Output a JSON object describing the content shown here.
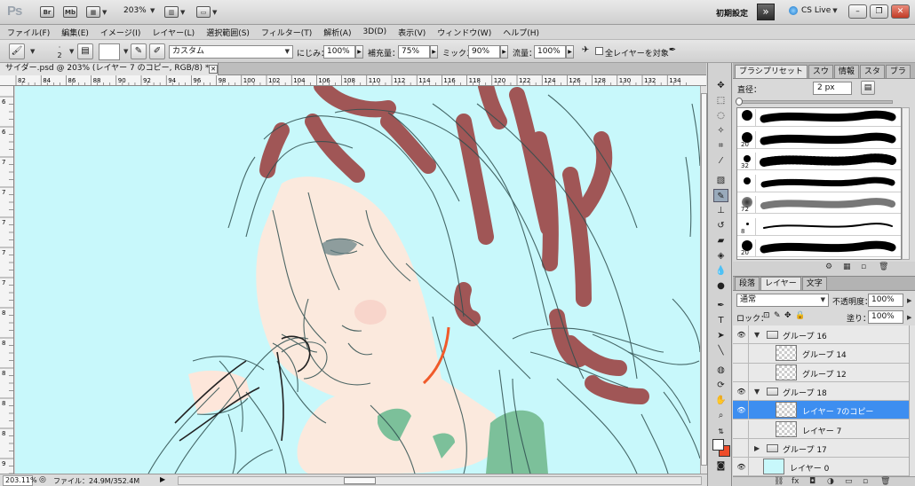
{
  "app": {
    "logo": "Ps",
    "mode_buttons": [
      "Br",
      "Mb"
    ],
    "zoom": "203%",
    "workspace": "初期設定",
    "cs_live": "CS Live"
  },
  "menu": [
    "ファイル(F)",
    "編集(E)",
    "イメージ(I)",
    "レイヤー(L)",
    "選択範囲(S)",
    "フィルター(T)",
    "解析(A)",
    "3D(D)",
    "表示(V)",
    "ウィンドウ(W)",
    "ヘルプ(H)"
  ],
  "options": {
    "brush_size": "2",
    "mode": "カスタム",
    "wet_label": "にじみ：",
    "wet_value": "100%",
    "load_label": "補充量：",
    "load_value": "75%",
    "mix_label": "ミックス：",
    "mix_value": "90%",
    "flow_label": "流量：",
    "flow_value": "100%",
    "sample_all_label": "全レイヤーを対象"
  },
  "document": {
    "tab_title": "サイダー.psd @ 203% (レイヤー 7 のコピー, RGB/8) *",
    "status_zoom": "203.11%",
    "status_file": "ファイル：24.9M/352.4M"
  },
  "ruler": {
    "top": [
      "82",
      "84",
      "86",
      "88",
      "90",
      "92",
      "94",
      "96",
      "98",
      "100",
      "102",
      "104",
      "106",
      "108",
      "110",
      "112",
      "114",
      "116",
      "118",
      "120",
      "122",
      "124",
      "126",
      "128",
      "130",
      "132",
      "134"
    ],
    "left": [
      "6",
      "6",
      "7",
      "7",
      "7",
      "7",
      "7",
      "8",
      "8",
      "8",
      "8",
      "8",
      "9"
    ]
  },
  "brush_panel": {
    "tabs": [
      "ブラシプリセット",
      "スウ",
      "情報",
      "スタ",
      "ブラ"
    ],
    "size_label": "直径：",
    "size_value": "2 px",
    "presets": [
      {
        "num": "",
        "kind": "hard"
      },
      {
        "num": "20",
        "kind": "hard"
      },
      {
        "num": "32",
        "kind": "spatter"
      },
      {
        "num": "",
        "kind": "texture"
      },
      {
        "num": "72",
        "kind": "soft"
      },
      {
        "num": "8",
        "kind": "thin"
      },
      {
        "num": "20",
        "kind": "hard"
      }
    ]
  },
  "layers_panel": {
    "tabs": [
      "段落",
      "レイヤー",
      "文字"
    ],
    "blend_mode": "通常",
    "opacity_label": "不透明度：",
    "opacity_value": "100%",
    "lock_label": "ロック：",
    "fill_label": "塗り：",
    "fill_value": "100%",
    "layers": [
      {
        "name": "グループ 16",
        "type": "group",
        "indent": 0,
        "expanded": true,
        "visible": true,
        "selected": false
      },
      {
        "name": "グループ 14",
        "type": "layer",
        "indent": 1,
        "visible": false,
        "selected": false
      },
      {
        "name": "グループ 12",
        "type": "layer",
        "indent": 1,
        "visible": false,
        "selected": false
      },
      {
        "name": "グループ 18",
        "type": "group",
        "indent": 0,
        "expanded": true,
        "visible": true,
        "selected": false
      },
      {
        "name": "レイヤー 7のコピー",
        "type": "layer",
        "indent": 1,
        "visible": true,
        "selected": true
      },
      {
        "name": "レイヤー 7",
        "type": "layer",
        "indent": 1,
        "visible": false,
        "selected": false
      },
      {
        "name": "グループ 17",
        "type": "group",
        "indent": 0,
        "expanded": false,
        "visible": false,
        "selected": false
      },
      {
        "name": "レイヤー 0",
        "type": "layer-fill",
        "indent": 0,
        "visible": true,
        "selected": false
      }
    ]
  },
  "colors": {
    "canvas": "#c8f8fb",
    "hair_stroke": "#a05555",
    "foreground": "#ffffff",
    "background": "#ee4c2a",
    "selection": "#3d8ef0"
  }
}
